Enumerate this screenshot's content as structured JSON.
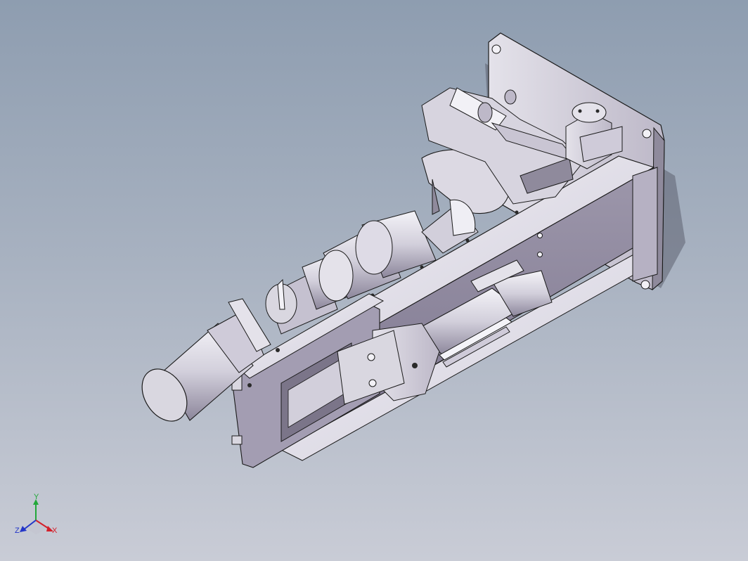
{
  "view": {
    "background_top": "#8e9db0",
    "background_bottom": "#c9ccd6",
    "part_color": "#d9d7e0",
    "part_shadow": "#8f8a9c",
    "edge_color": "#1a1a1a"
  },
  "triad": {
    "x_label": "X",
    "y_label": "Y",
    "z_label": "Z",
    "x_color": "#d4202a",
    "y_color": "#22a83a",
    "z_color": "#2336c8"
  }
}
